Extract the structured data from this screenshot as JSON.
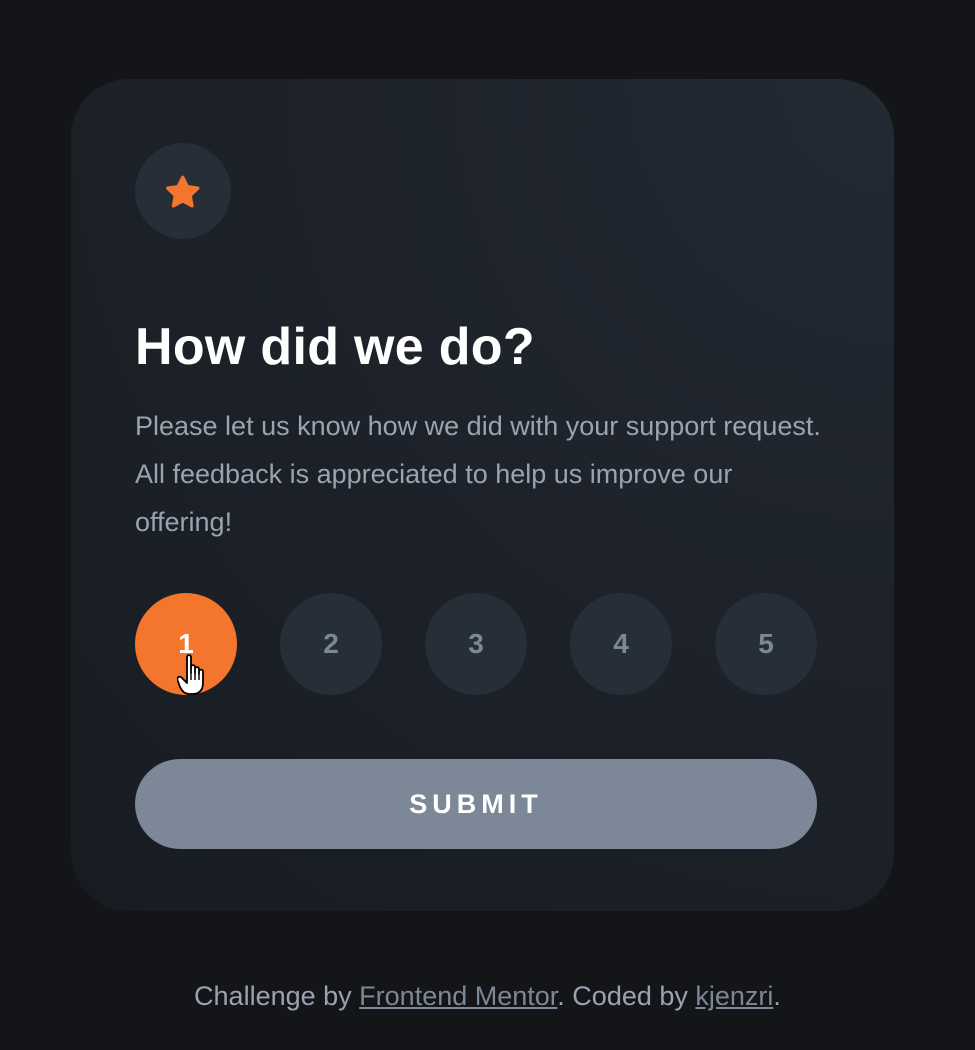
{
  "card": {
    "icon": "star-icon",
    "title": "How did we do?",
    "description": "Please let us know how we did with your support request. All feedback is appreciated to help us improve our offering!",
    "ratings": [
      "1",
      "2",
      "3",
      "4",
      "5"
    ],
    "selected_rating": "1",
    "submit_label": "SUBMIT"
  },
  "footer": {
    "prefix": "Challenge by ",
    "link1": "Frontend Mentor",
    "middle": ". Coded by ",
    "link2": "kjenzri",
    "suffix": "."
  },
  "colors": {
    "background": "#131518",
    "card": "#1e232b",
    "accent": "#f4762c",
    "muted": "#7c8798",
    "text_light": "#9aa3b1",
    "circle": "#262e38"
  }
}
